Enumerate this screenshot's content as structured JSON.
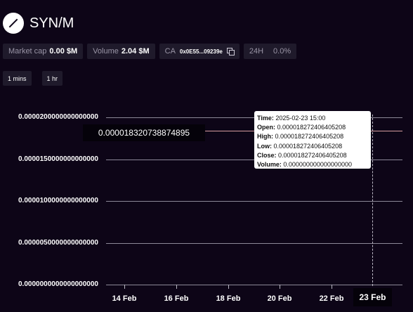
{
  "token": {
    "name": "SYN/M"
  },
  "stats": {
    "market_cap_label": "Market cap",
    "market_cap_value": "0.00 $M",
    "volume_label": "Volume",
    "volume_value": "2.04 $M",
    "ca_label": "CA",
    "ca_value": "0x0E55...09239e",
    "change_label": "24H",
    "change_value": "0.0%"
  },
  "intervals": [
    "1 mins",
    "1 hr"
  ],
  "chart_data": {
    "type": "line",
    "y_ticks": [
      "0.0000200000000000000",
      "0.0000150000000000000",
      "0.0000100000000000000",
      "0.0000050000000000000",
      "0.0000000000000000000"
    ],
    "x_ticks": [
      "14 Feb",
      "16 Feb",
      "18 Feb",
      "20 Feb",
      "22 Feb"
    ],
    "x_active": "23 Feb",
    "ylim": [
      0,
      2e-05
    ],
    "last_price": "0.000018320738874895",
    "points": [
      {
        "x": "2025-02-23 15:00",
        "y": 1.8272406405208e-05
      }
    ],
    "grid": true,
    "tooltip": {
      "time_label": "Time:",
      "time": "2025-02-23 15:00",
      "open_label": "Open:",
      "open": "0.000018272406405208",
      "high_label": "High:",
      "high": "0.000018272406405208",
      "low_label": "Low:",
      "low": "0.000018272406405208",
      "close_label": "Close:",
      "close": "0.000018272406405208",
      "volume_label": "Volume:",
      "volume": "0.000000000000000000"
    }
  },
  "colors": {
    "background": "#0d0517",
    "panel": "#1f1a2b",
    "price_line": "#d79ea0",
    "grid": "#8c8897"
  }
}
